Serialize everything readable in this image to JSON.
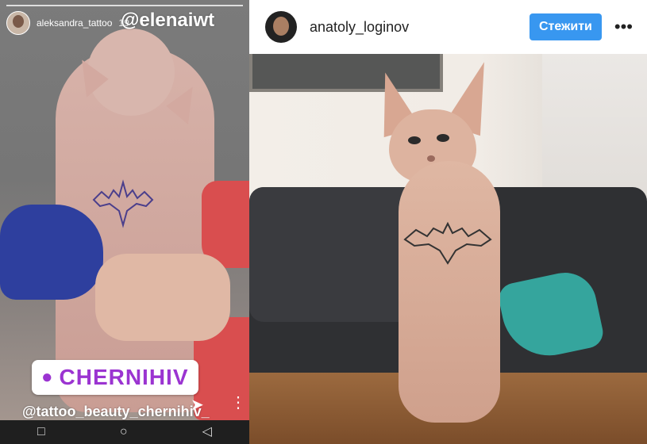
{
  "story": {
    "username": "aleksandra_tattoo",
    "time": "19",
    "mention_top": "@elenaiwt",
    "location": "CHERNIHIV",
    "mention_bottom": "@tattoo_beauty_chernihiv_"
  },
  "post": {
    "username": "anatoly_loginov",
    "follow_label": "Стежити",
    "more_label": "•••"
  },
  "icons": {
    "location": "location-pin-icon",
    "send": "send-icon",
    "more": "more-icon",
    "nav_square": "recent-apps-icon",
    "nav_circle": "home-icon",
    "nav_back": "back-icon"
  },
  "colors": {
    "follow_button": "#3897f0",
    "location_text": "#9b34d1",
    "sleeve": "#d94e4f",
    "glove": "#2e3f9e"
  }
}
